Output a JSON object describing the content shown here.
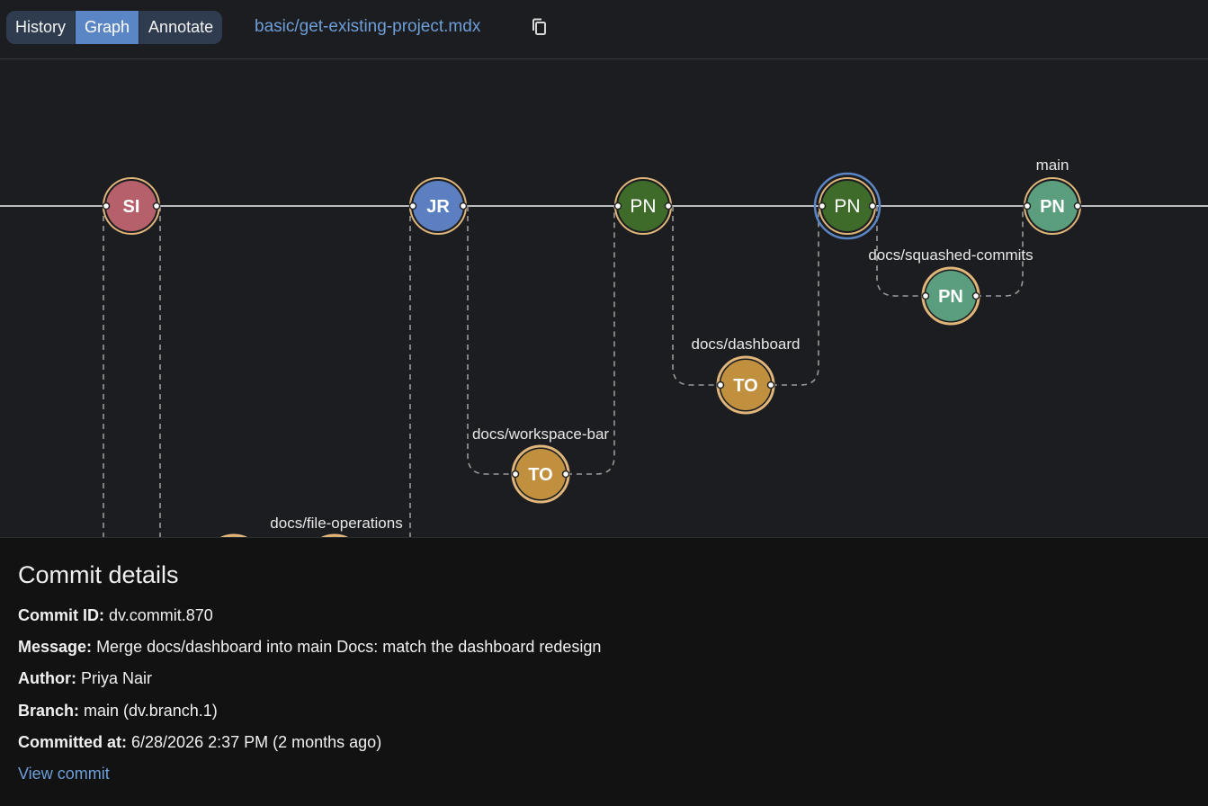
{
  "toolbar": {
    "tabs": [
      {
        "label": "History",
        "active": false
      },
      {
        "label": "Graph",
        "active": true
      },
      {
        "label": "Annotate",
        "active": false
      }
    ],
    "file_path": "basic/get-existing-project.mdx",
    "copy_icon": "copy-icon"
  },
  "graph": {
    "commits": [
      {
        "initials": "SI",
        "color": "#b5606a",
        "selected": false
      },
      {
        "initials": "JR",
        "color": "#5b7fc0",
        "selected": false
      },
      {
        "initials": "PN",
        "color": "#3e6b2a",
        "selected": false
      },
      {
        "initials": "PN",
        "color": "#3e6b2a",
        "selected": true
      },
      {
        "initials": "PN",
        "color": "#5a9e7e",
        "selected": false,
        "branch_label": "main"
      },
      {
        "initials": "PN",
        "color": "#5a9e7e",
        "selected": false,
        "branch_label": "docs/squashed-commits"
      },
      {
        "initials": "TO",
        "color": "#c0903f",
        "selected": false,
        "branch_label": "docs/dashboard"
      },
      {
        "initials": "TO",
        "color": "#c0903f",
        "selected": false,
        "branch_label": "docs/workspace-bar"
      },
      {
        "initials": "",
        "color": "#c0903f",
        "selected": false,
        "branch_label": "docs/file-operations"
      }
    ],
    "ring_color": "#e0b57a",
    "selected_ring_color": "#5b86c5",
    "line_color": "#bdbdbd"
  },
  "details": {
    "title": "Commit details",
    "commit_id_label": "Commit ID:",
    "commit_id": "dv.commit.870",
    "message_label": "Message:",
    "message": "Merge docs/dashboard into main Docs: match the dashboard redesign",
    "author_label": "Author:",
    "author": "Priya Nair",
    "branch_label": "Branch:",
    "branch": "main (dv.branch.1)",
    "committed_label": "Committed at:",
    "committed": "6/28/2026 2:37 PM (2 months ago)",
    "view_commit": "View commit"
  }
}
